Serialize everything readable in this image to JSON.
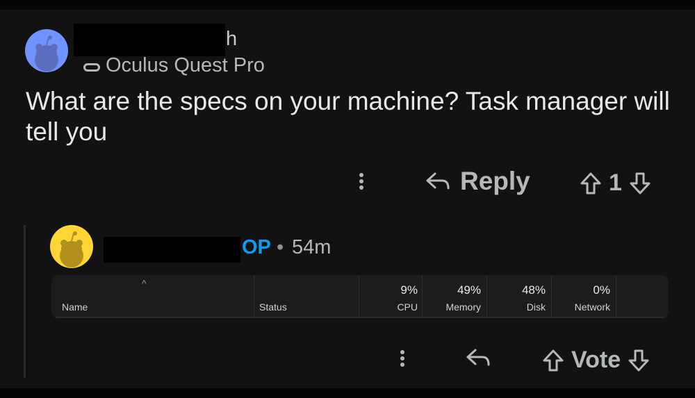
{
  "comments": [
    {
      "username_visible": "h",
      "flair": "Oculus Quest Pro",
      "body": "What are the specs on your machine? Task manager will tell you",
      "actions": {
        "reply_label": "Reply",
        "score": "1"
      }
    },
    {
      "op_tag": "OP",
      "separator": "•",
      "time": "54m",
      "actions": {
        "vote_label": "Vote"
      }
    }
  ],
  "task_manager": {
    "columns": [
      {
        "header": "Name",
        "value": ""
      },
      {
        "header": "Status",
        "value": ""
      },
      {
        "header": "CPU",
        "value": "9%"
      },
      {
        "header": "Memory",
        "value": "49%"
      },
      {
        "header": "Disk",
        "value": "48%"
      },
      {
        "header": "Network",
        "value": "0%"
      }
    ],
    "sort_indicator": "^"
  },
  "colors": {
    "background": "#121212",
    "op_blue": "#0f9bf0",
    "avatar1": "#7193ff",
    "avatar2": "#ffd635"
  },
  "icons": [
    "snoo-avatar-icon",
    "flair-icon",
    "kebab-menu-icon",
    "reply-arrow-icon",
    "upvote-icon",
    "downvote-icon"
  ]
}
